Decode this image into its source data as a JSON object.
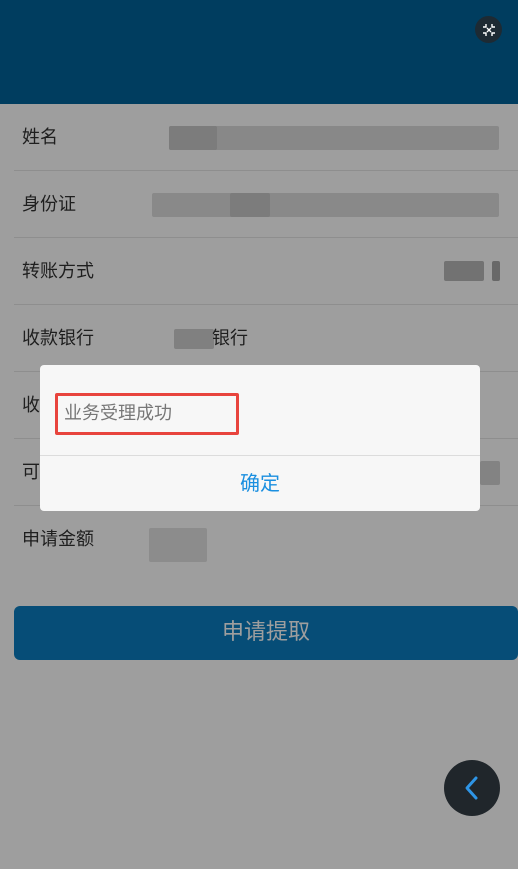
{
  "form": {
    "rows": [
      {
        "label": "姓名"
      },
      {
        "label": "身份证"
      },
      {
        "label": "转账方式"
      },
      {
        "label": "收款银行",
        "value_suffix": "银行"
      },
      {
        "label": "收"
      },
      {
        "label": "可"
      },
      {
        "label": "申请金额"
      }
    ]
  },
  "submit": {
    "label": "申请提取"
  },
  "dialog": {
    "message": "业务受理成功",
    "confirm_label": "确定"
  },
  "icons": {
    "fullscreen": "fullscreen-exit-icon",
    "back": "chevron-left-icon"
  },
  "colors": {
    "header": "#00639a",
    "button": "#0a7cc0",
    "highlight": "#e8443d",
    "link": "#1a8fe0"
  }
}
